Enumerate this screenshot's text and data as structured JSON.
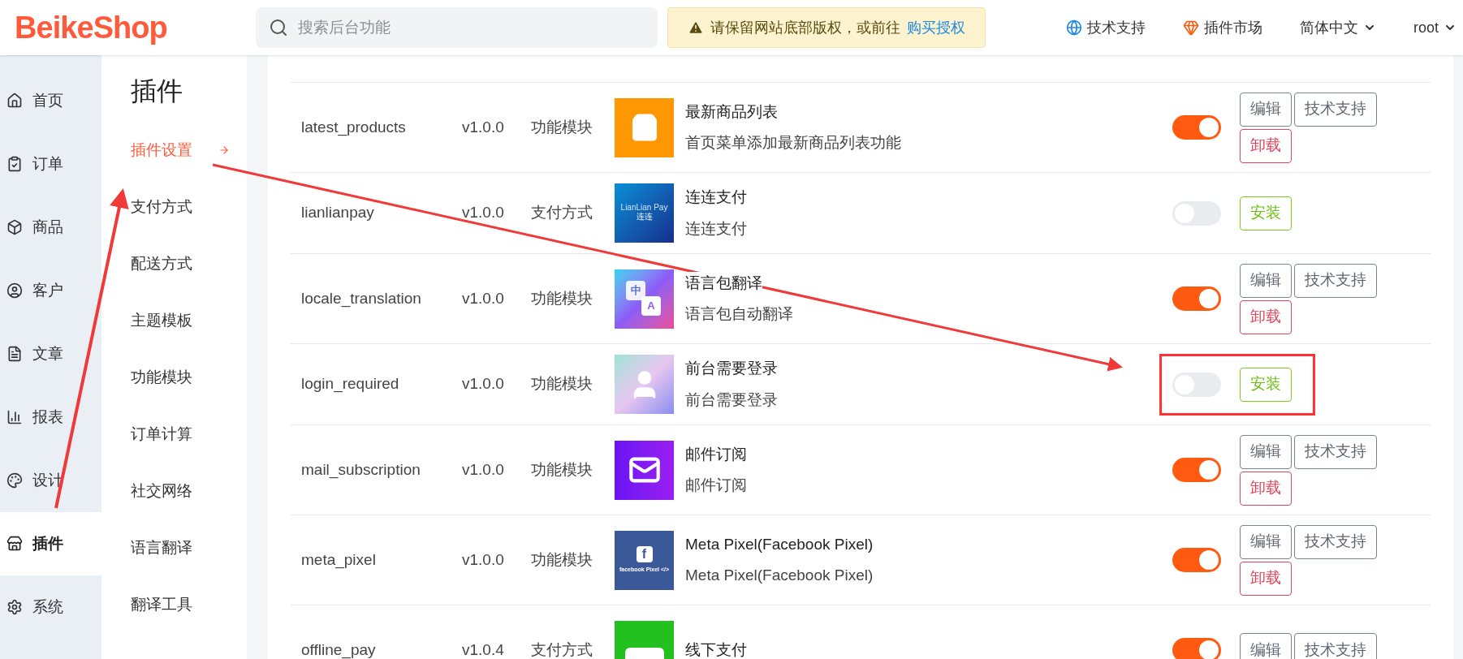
{
  "header": {
    "logo": "BeikeShop",
    "search": {
      "placeholder": "搜索后台功能"
    },
    "notice": {
      "text": "请保留网站底部版权，或前往",
      "link": "购买授权"
    },
    "links": [
      {
        "kind": "support",
        "label": "技术支持"
      },
      {
        "kind": "market",
        "label": "插件市场"
      },
      {
        "kind": "language",
        "label": "简体中文"
      },
      {
        "kind": "user",
        "label": "root"
      }
    ]
  },
  "sidebar": {
    "items": [
      {
        "kind": "home",
        "label": "首页",
        "selected": false
      },
      {
        "kind": "order",
        "label": "订单",
        "selected": false
      },
      {
        "kind": "product",
        "label": "商品",
        "selected": false
      },
      {
        "kind": "customer",
        "label": "客户",
        "selected": false
      },
      {
        "kind": "article",
        "label": "文章",
        "selected": false
      },
      {
        "kind": "report",
        "label": "报表",
        "selected": false
      },
      {
        "kind": "design",
        "label": "设计",
        "selected": false
      },
      {
        "kind": "plugin",
        "label": "插件",
        "selected": true
      },
      {
        "kind": "system",
        "label": "系统",
        "selected": false
      }
    ]
  },
  "submenu": {
    "title": "插件",
    "items": [
      {
        "label": "插件设置",
        "selected": true
      },
      {
        "label": "支付方式",
        "selected": false
      },
      {
        "label": "配送方式",
        "selected": false
      },
      {
        "label": "主题模板",
        "selected": false
      },
      {
        "label": "功能模块",
        "selected": false
      },
      {
        "label": "订单计算",
        "selected": false
      },
      {
        "label": "社交网络",
        "selected": false
      },
      {
        "label": "语言翻译",
        "selected": false
      },
      {
        "label": "翻译工具",
        "selected": false
      }
    ]
  },
  "rows": [
    {
      "code": "latest_products",
      "version": "v1.0.0",
      "type": "功能模块",
      "kind": "bag",
      "title": "最新商品列表",
      "description": "首页菜单添加最新商品列表功能",
      "enabled": true,
      "buttons": [
        {
          "kind": "edit",
          "label": "编辑"
        },
        {
          "kind": "support",
          "label": "技术支持"
        },
        {
          "kind": "uninstall",
          "label": "卸载"
        }
      ]
    },
    {
      "code": "lianlianpay",
      "version": "v1.0.0",
      "type": "支付方式",
      "kind": "lianlian",
      "icon_text": [
        "LianLian Pay",
        "连连"
      ],
      "title": "连连支付",
      "description": "连连支付",
      "enabled": false,
      "buttons": [
        {
          "kind": "install",
          "label": "安装"
        }
      ]
    },
    {
      "code": "locale_translation",
      "version": "v1.0.0",
      "type": "功能模块",
      "kind": "translate",
      "icon_text": [
        "中",
        "A"
      ],
      "title": "语言包翻译",
      "description": "语言包自动翻译",
      "enabled": true,
      "buttons": [
        {
          "kind": "edit",
          "label": "编辑"
        },
        {
          "kind": "support",
          "label": "技术支持"
        },
        {
          "kind": "uninstall",
          "label": "卸载"
        }
      ]
    },
    {
      "code": "login_required",
      "version": "v1.0.0",
      "type": "功能模块",
      "kind": "person",
      "title": "前台需要登录",
      "description": "前台需要登录",
      "enabled": false,
      "highlighted": true,
      "buttons": [
        {
          "kind": "install",
          "label": "安装"
        }
      ]
    },
    {
      "code": "mail_subscription",
      "version": "v1.0.0",
      "type": "功能模块",
      "kind": "mail",
      "title": "邮件订阅",
      "description": "邮件订阅",
      "enabled": true,
      "buttons": [
        {
          "kind": "edit",
          "label": "编辑"
        },
        {
          "kind": "support",
          "label": "技术支持"
        },
        {
          "kind": "uninstall",
          "label": "卸载"
        }
      ]
    },
    {
      "code": "meta_pixel",
      "version": "v1.0.0",
      "type": "功能模块",
      "kind": "facebook",
      "icon_text": [
        "f",
        "facebook Pixel </>"
      ],
      "title": "Meta Pixel(Facebook Pixel)",
      "description": "Meta Pixel(Facebook Pixel)",
      "enabled": true,
      "buttons": [
        {
          "kind": "edit",
          "label": "编辑"
        },
        {
          "kind": "support",
          "label": "技术支持"
        },
        {
          "kind": "uninstall",
          "label": "卸载"
        }
      ]
    },
    {
      "code": "offline_pay",
      "version": "v1.0.4",
      "type": "支付方式",
      "kind": "offline",
      "title": "线下支付",
      "enabled": true,
      "buttons": [
        {
          "kind": "edit",
          "label": "编辑"
        },
        {
          "kind": "support",
          "label": "技术支持"
        }
      ]
    }
  ]
}
